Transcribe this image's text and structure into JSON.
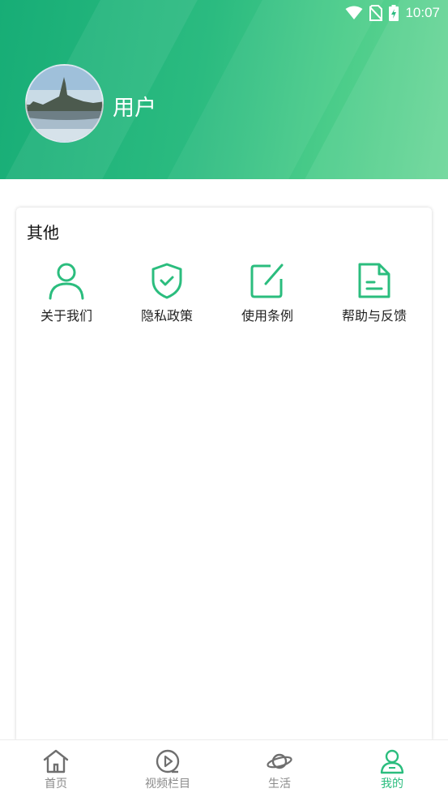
{
  "status_bar": {
    "time": "10:07"
  },
  "profile": {
    "username": "用户"
  },
  "other_section": {
    "title": "其他",
    "items": [
      {
        "label": "关于我们",
        "icon": "person-icon"
      },
      {
        "label": "隐私政策",
        "icon": "shield-check-icon"
      },
      {
        "label": "使用条例",
        "icon": "edit-square-icon"
      },
      {
        "label": "帮助与反馈",
        "icon": "document-icon"
      }
    ]
  },
  "bottom_nav": {
    "items": [
      {
        "label": "首页",
        "icon": "home-icon",
        "active": false
      },
      {
        "label": "视频栏目",
        "icon": "play-circle-icon",
        "active": false
      },
      {
        "label": "生活",
        "icon": "planet-icon",
        "active": false
      },
      {
        "label": "我的",
        "icon": "user-icon",
        "active": true
      }
    ]
  },
  "colors": {
    "accent": "#2bbd7e",
    "header_gradient_start": "#17ad76",
    "header_gradient_end": "#6bd698",
    "nav_inactive": "#8a8a8a"
  }
}
